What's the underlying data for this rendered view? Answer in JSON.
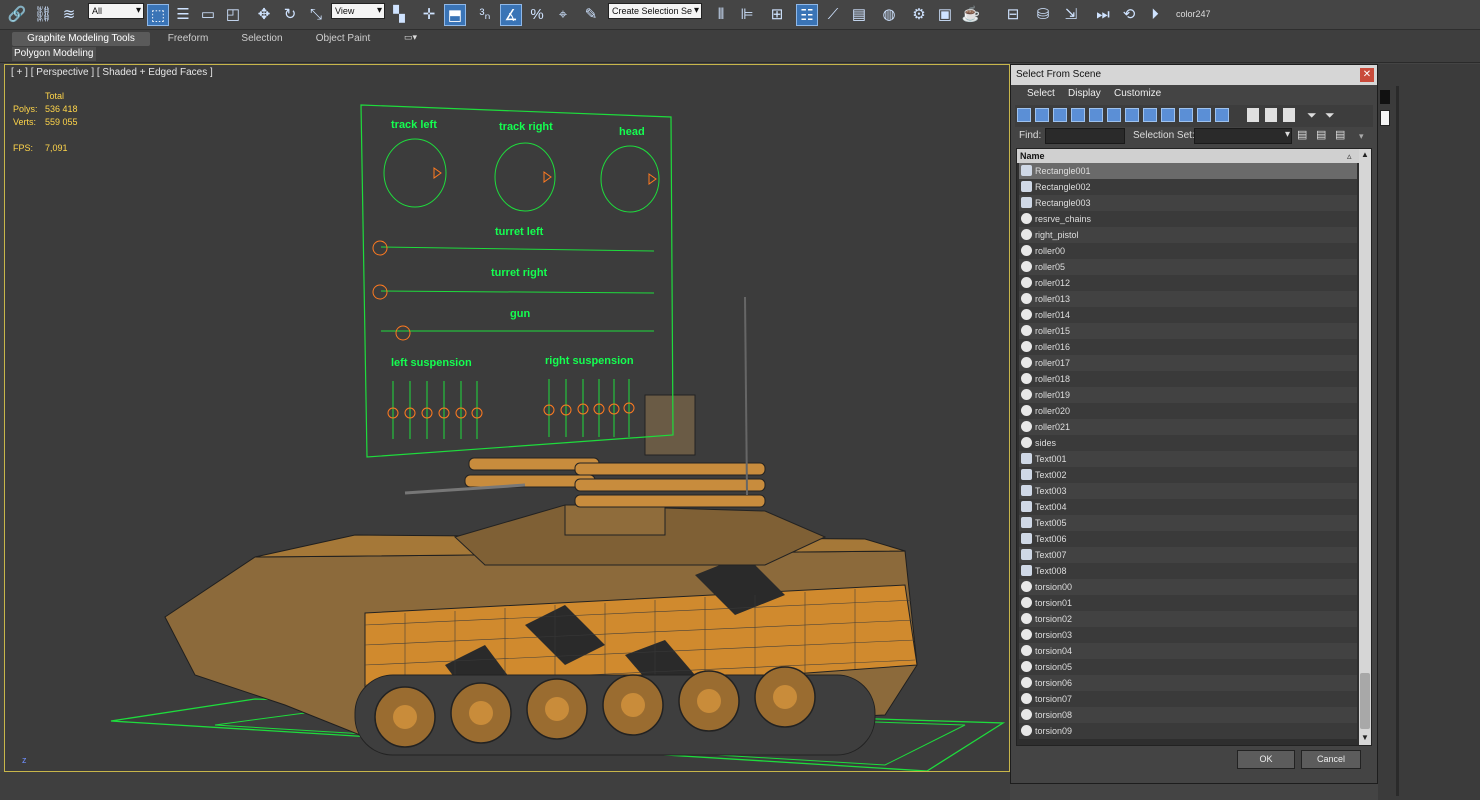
{
  "toolbar": {
    "filter_select": "All",
    "coord_select": "View",
    "selection_set_select": "Create Selection Se",
    "color_label": "color247"
  },
  "ribbon": {
    "tabs": [
      "Graphite Modeling Tools",
      "Freeform",
      "Selection",
      "Object Paint"
    ],
    "active_tab": "Graphite Modeling Tools",
    "sub_label": "Polygon Modeling"
  },
  "viewport": {
    "label": "[ + ] [ Perspective ] [ Shaded + Edged Faces ]",
    "stats": {
      "header": "Total",
      "polys_label": "Polys:",
      "polys_value": "536 418",
      "verts_label": "Verts:",
      "verts_value": "559 055",
      "fps_label": "FPS:",
      "fps_value": "7,091"
    },
    "axis_label": "z",
    "control_labels": {
      "track_left": "track left",
      "track_right": "track right",
      "head": "head",
      "turret_left": "turret left",
      "turret_right": "turret right",
      "gun": "gun",
      "left_suspension": "left suspension",
      "right_suspension": "right suspension"
    }
  },
  "dialog": {
    "title": "Select From Scene",
    "menu": [
      "Select",
      "Display",
      "Customize"
    ],
    "find_label": "Find:",
    "selection_set_label": "Selection Set:",
    "column_header": "Name",
    "items": [
      "Rectangle001",
      "Rectangle002",
      "Rectangle003",
      "resrve_chains",
      "right_pistol",
      "roller00",
      "roller05",
      "roller012",
      "roller013",
      "roller014",
      "roller015",
      "roller016",
      "roller017",
      "roller018",
      "roller019",
      "roller020",
      "roller021",
      "sides",
      "Text001",
      "Text002",
      "Text003",
      "Text004",
      "Text005",
      "Text006",
      "Text007",
      "Text008",
      "torsion00",
      "torsion01",
      "torsion02",
      "torsion03",
      "torsion04",
      "torsion05",
      "torsion06",
      "torsion07",
      "torsion08",
      "torsion09"
    ],
    "ok_label": "OK",
    "cancel_label": "Cancel"
  }
}
